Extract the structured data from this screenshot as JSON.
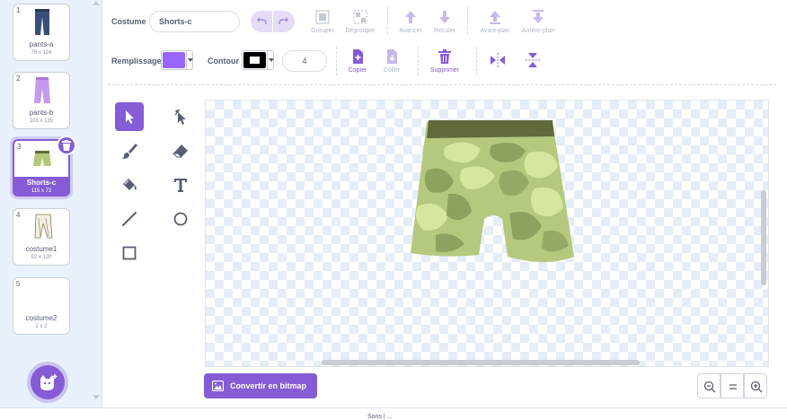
{
  "costumes": [
    {
      "num": "1",
      "name": "pants-a",
      "size": "76 x 124"
    },
    {
      "num": "2",
      "name": "pants-b",
      "size": "103 x 135"
    },
    {
      "num": "3",
      "name": "Shorts-c",
      "size": "115 x 72"
    },
    {
      "num": "4",
      "name": "costume1",
      "size": "92 x 120"
    },
    {
      "num": "5",
      "name": "costume2",
      "size": "2 x 2"
    }
  ],
  "toolbar": {
    "costume_label": "Costume",
    "costume_name": "Shorts-c",
    "group": "Grouper",
    "ungroup": "Dégrouper",
    "forward": "Avancer",
    "backward": "Reculer",
    "front": "Avant-plan",
    "back": "Arrière-plan",
    "fill_label": "Remplissage",
    "outline_label": "Contour",
    "outline_width": "4",
    "copy": "Copier",
    "paste": "Coller",
    "delete": "Supprimer"
  },
  "colors": {
    "accent": "#855cd6",
    "fill": "#9966ff",
    "outline": "#000000",
    "shorts_base": "#b4c97d",
    "shorts_waist": "#5f6b3b"
  },
  "bottom": {
    "convert_bitmap": "Convertir en bitmap"
  },
  "footer": {
    "text": "Sons | ..."
  }
}
